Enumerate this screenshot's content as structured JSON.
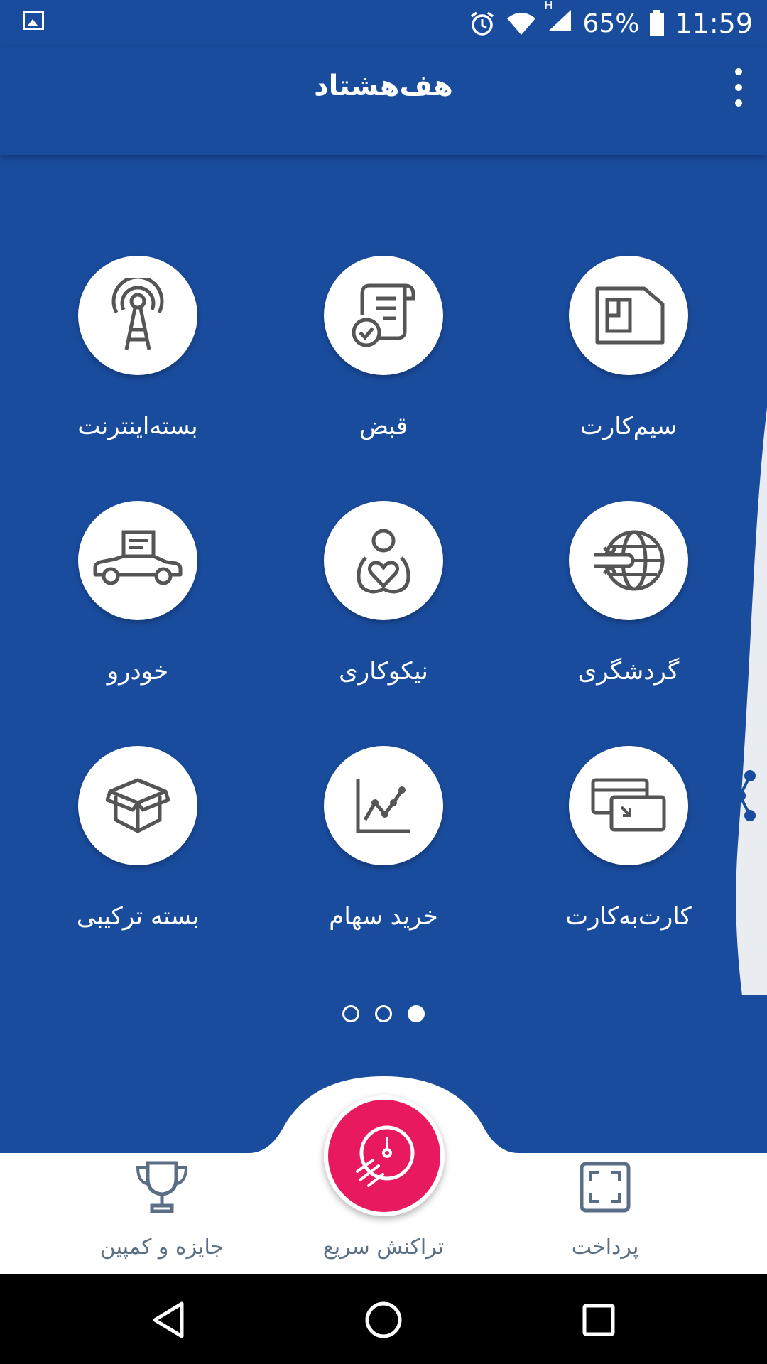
{
  "status_bar": {
    "battery": "65%",
    "time": "11:59",
    "network_type": "H"
  },
  "app_bar": {
    "title": "هف‌هشتاد"
  },
  "tiles": [
    {
      "label": "سیم‌کارت",
      "icon": "sim-card-icon"
    },
    {
      "label": "قبض",
      "icon": "bill-icon"
    },
    {
      "label": "بسته‌اینترنت",
      "icon": "antenna-icon"
    },
    {
      "label": "گردشگری",
      "icon": "travel-globe-icon"
    },
    {
      "label": "نیکوکاری",
      "icon": "charity-icon"
    },
    {
      "label": "خودرو",
      "icon": "car-icon"
    },
    {
      "label": "کارت‌به‌کارت",
      "icon": "card-transfer-icon"
    },
    {
      "label": "خرید سهام",
      "icon": "stock-chart-icon"
    },
    {
      "label": "بسته ترکیبی",
      "icon": "box-icon"
    }
  ],
  "pager": {
    "pages": 3,
    "active_index": 2
  },
  "bottom_nav": {
    "payment_label": "پرداخت",
    "quick_label": "تراکنش سریع",
    "prize_label": "جایزه و کمپین"
  },
  "colors": {
    "primary": "#1a4c9e",
    "accent": "#e8195e",
    "nav_text": "#5a6f86"
  }
}
